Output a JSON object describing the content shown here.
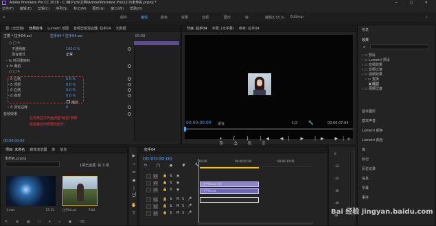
{
  "window": {
    "title": "Adobe Premiere Pro CC 2018 - C:\\用户\\zh\\文档\\Adobe\\Premiere Pro\\12.0\\未命名.prproj *"
  },
  "menu": [
    "文件(F)",
    "编辑(E)",
    "剪辑(C)",
    "序列(S)",
    "标记(M)",
    "图形(G)",
    "窗口(W)",
    "帮助(H)"
  ],
  "workspaces": [
    "组件",
    "编辑",
    "颜色",
    "效果",
    "音频",
    "图形",
    "库",
    "编辑(CS5.5)",
    "Editing"
  ],
  "effect_controls": {
    "tabs": [
      "源: (无剪辑)",
      "效果控件",
      "Lumetri 范围",
      "音频剪辑混合器: 拉手04",
      "元数据"
    ],
    "master_label": "主要 * 拉手04.avi",
    "clip_label": "拉手04 * 拉手04.avi",
    "timecode": "00:00",
    "rows": [
      {
        "label": "不透明度",
        "value": "100.0 %"
      },
      {
        "label": "混合模式",
        "value": "正常"
      },
      {
        "label": "时间重映射",
        "value": ""
      },
      {
        "label": "裁剪",
        "value": ""
      },
      {
        "label": "左侧",
        "value": "0.0 %"
      },
      {
        "label": "顶部",
        "value": "0.0 %"
      },
      {
        "label": "右侧",
        "value": "0.0 %"
      },
      {
        "label": "底部",
        "value": "0.0 %"
      },
      {
        "label": "羽化边缘",
        "value": "0"
      }
    ],
    "zoom_checkbox": "缩放",
    "audio_label": "音频效果",
    "annotation": "在效果控件界面调整\"裁剪\"参数\n就能裁剪出想要的部分。",
    "footer_time": "00:00:00:00"
  },
  "program": {
    "tabs": [
      "节目: 拉手04",
      "字幕: (无字幕)",
      "参考: 拉手04"
    ],
    "timecode": "00:00:00:00",
    "fit": "适合",
    "ratio": "1/2",
    "duration": "00:00:07:04"
  },
  "library": {
    "tabs": [
      "信息",
      "效果",
      "基本图形",
      "基本声音",
      "Lumetri 颜色",
      "库",
      "标记",
      "历史记录",
      "字幕",
      "事件"
    ],
    "title": "效果",
    "tree": [
      {
        "label": "预设",
        "indent": 0
      },
      {
        "label": "Lumetri 预设",
        "indent": 0
      },
      {
        "label": "音频效果",
        "indent": 0
      },
      {
        "label": "音频过渡",
        "indent": 0
      },
      {
        "label": "视频效果",
        "indent": 0
      },
      {
        "label": "变换",
        "indent": 1
      },
      {
        "label": "裁剪",
        "indent": 2
      },
      {
        "label": "视频过渡",
        "indent": 0
      }
    ],
    "sections": [
      "基本图形",
      "基本声音",
      "Lumetri 颜色",
      "Lumetri 颜色",
      "库",
      "标记",
      "历史记录",
      "信息",
      "字幕",
      "事件"
    ]
  },
  "project": {
    "tabs": [
      "项目: 未命名",
      "媒体浏览器",
      "库",
      "信息"
    ],
    "file": "未命名.prproj",
    "selection": "1项已选择, 共 3 项",
    "items": [
      {
        "name": "1.mov",
        "duration": "27:11"
      },
      {
        "name": "拉手04.avi",
        "duration": "7:04"
      }
    ]
  },
  "timeline": {
    "tab": "拉手04",
    "timecode": "00:00:00:00",
    "ruler": [
      "00:00",
      "00:00:05:00",
      "00:00:10:00"
    ],
    "video_tracks": [
      "V3",
      "V2",
      "V1"
    ],
    "audio_tracks": [
      "A1",
      "A2",
      "A3"
    ],
    "clips": [
      "拉手04.avi [V]",
      "拉手04.avi"
    ],
    "levels": [
      "0",
      "-12",
      "-24",
      "-36",
      "-48",
      "dB"
    ]
  },
  "watermark": "Bai 经验 jingyan.baidu.com"
}
